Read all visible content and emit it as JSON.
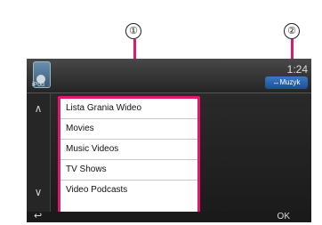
{
  "callouts": {
    "one": "①",
    "two": "②"
  },
  "header": {
    "source_label": "iPod",
    "time": "1:24",
    "source_button": "↔Muzyk"
  },
  "list": {
    "items": [
      {
        "label": "Lista Grania Wideo"
      },
      {
        "label": "Movies"
      },
      {
        "label": "Music Videos"
      },
      {
        "label": "TV Shows"
      },
      {
        "label": "Video Podcasts"
      }
    ]
  },
  "footer": {
    "back_icon": "↩",
    "ok_label": "OK"
  },
  "colors": {
    "callout_line": "#e0196b",
    "source_button": "#2a64ad"
  }
}
